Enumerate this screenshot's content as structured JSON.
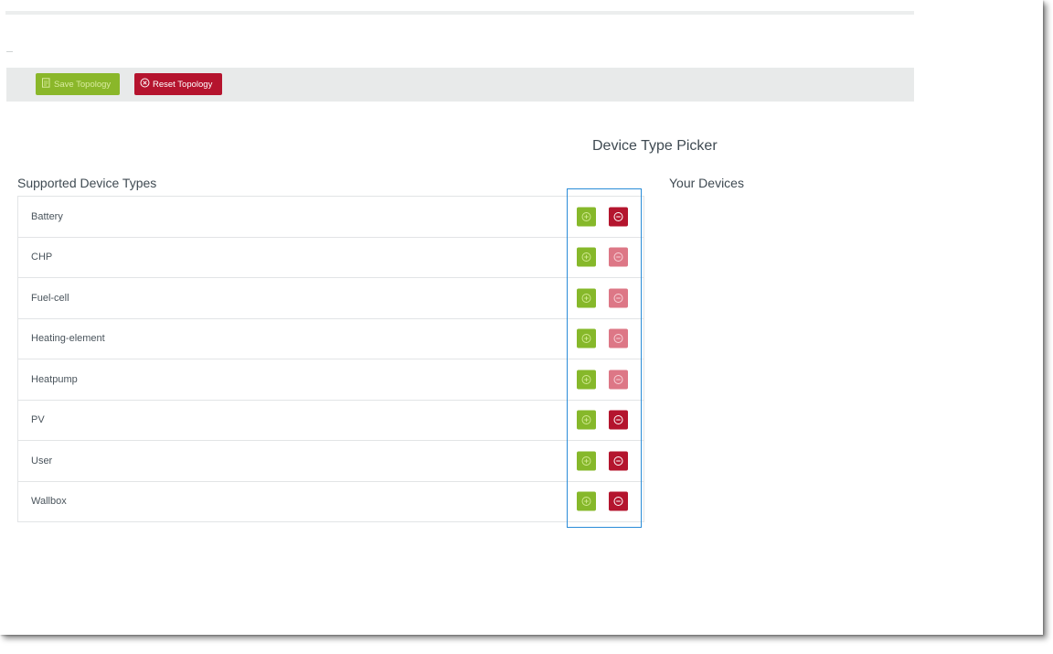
{
  "toolbar": {
    "save_label": "Save Topology",
    "reset_label": "Reset Topology",
    "save_icon": "file-save-icon",
    "reset_icon": "circle-x-icon"
  },
  "picker": {
    "title": "Device Type Picker",
    "supported_header": "Supported Device Types",
    "your_devices_header": "Your Devices"
  },
  "devices": [
    {
      "label": "Battery",
      "remove_enabled": true
    },
    {
      "label": "CHP",
      "remove_enabled": false
    },
    {
      "label": "Fuel-cell",
      "remove_enabled": false
    },
    {
      "label": "Heating-element",
      "remove_enabled": false
    },
    {
      "label": "Heatpump",
      "remove_enabled": false
    },
    {
      "label": "PV",
      "remove_enabled": true
    },
    {
      "label": "User",
      "remove_enabled": true
    },
    {
      "label": "Wallbox",
      "remove_enabled": true
    }
  ],
  "colors": {
    "add_button": "#86b82a",
    "remove_button_active": "#b4152e",
    "remove_button_disabled": "#dd7786",
    "highlight_border": "#2a8cd8",
    "toolbar_bg": "#e8eaea"
  }
}
